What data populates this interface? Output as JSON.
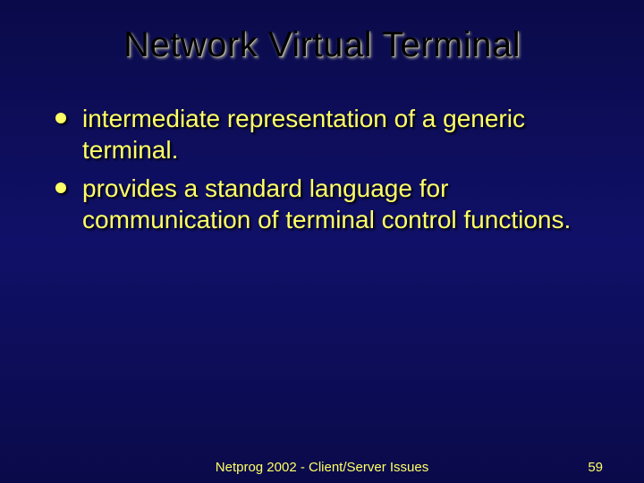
{
  "slide": {
    "title": "Network Virtual Terminal",
    "bullets": [
      "intermediate representation of a generic terminal.",
      "provides a standard language for communication of terminal control functions."
    ],
    "footer_center": "Netprog 2002 - Client/Server Issues",
    "footer_page": "59"
  }
}
